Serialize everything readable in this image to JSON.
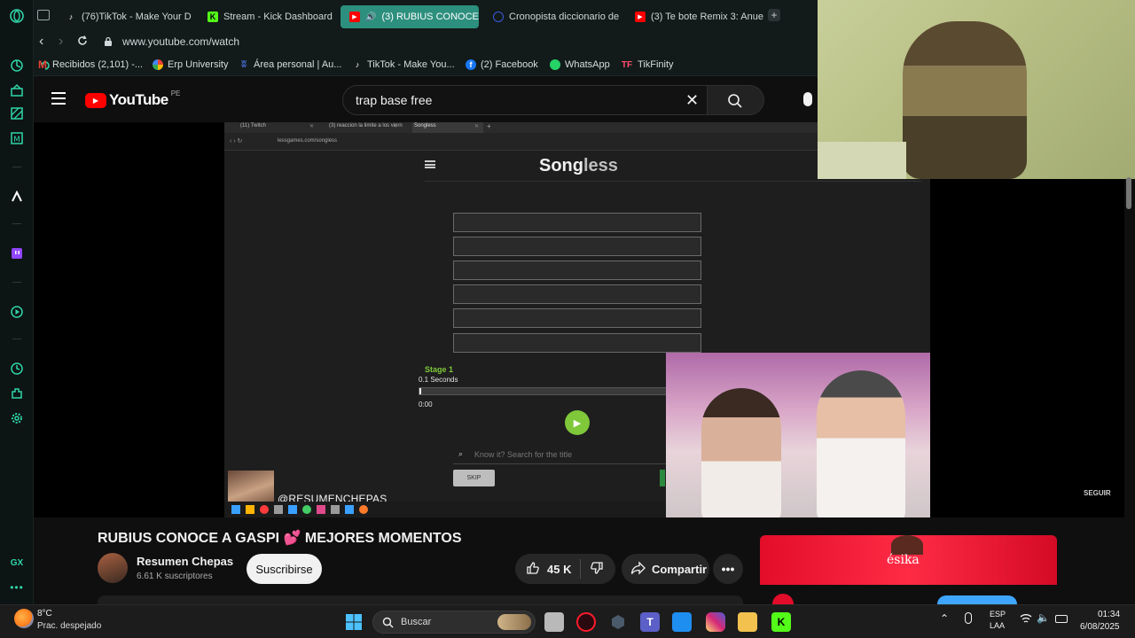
{
  "browser": {
    "tabs": [
      {
        "label": "(76)TikTok - Make Your D",
        "icon": "tiktok-icon",
        "active": false
      },
      {
        "label": "Stream - Kick Dashboard",
        "icon": "kick-icon",
        "active": false
      },
      {
        "label": "(3) RUBIUS CONOCE",
        "icon": "youtube-icon",
        "active": true
      },
      {
        "label": "Cronopista diccionario de",
        "icon": "globe-icon",
        "active": false
      },
      {
        "label": "(3) Te bote Remix 3: Anue",
        "icon": "youtube-icon",
        "active": false
      }
    ],
    "url": "www.youtube.com/watch",
    "bookmarks": [
      {
        "label": "Recibidos (2,101) -...",
        "icon": "gmail-icon"
      },
      {
        "label": "Erp University",
        "icon": "erp-icon"
      },
      {
        "label": "Área personal | Au...",
        "icon": "moodle-icon"
      },
      {
        "label": "TikTok - Make You...",
        "icon": "tiktok-icon"
      },
      {
        "label": "(2) Facebook",
        "icon": "facebook-icon"
      },
      {
        "label": "WhatsApp",
        "icon": "whatsapp-icon"
      },
      {
        "label": "TikFinity",
        "icon": "tikfinity-icon"
      }
    ]
  },
  "youtube": {
    "logo_text": "YouTube",
    "country": "PE",
    "search_value": "trap base free"
  },
  "video": {
    "inner_tabs": [
      "(11) Twitch",
      "(3) reaccion la limite a los viern",
      "Songless"
    ],
    "inner_url": "lessgames.com/songless",
    "app_title_bold": "Song",
    "app_title_light": "less",
    "stage_label": "Stage 1",
    "seconds_label": "0.1 Seconds",
    "time_label": "0:00",
    "search_placeholder": "Know it? Search for the title",
    "skip_label": "SKIP",
    "watermark": "@RESUMENCHEPAS",
    "follow_label": "SEGUIR"
  },
  "meta": {
    "title": "RUBIUS CONOCE A GASPI 💕 MEJORES MOMENTOS",
    "channel_name": "Resumen Chepas",
    "subscribers": "6.61 K suscriptores",
    "subscribe_label": "Suscribirse",
    "likes": "45 K",
    "share_label": "Compartir",
    "ad_brand": "ésika"
  },
  "taskbar": {
    "temperature": "8°C",
    "weather": "Prac. despejado",
    "search_label": "Buscar",
    "lang_top": "ESP",
    "lang_bottom": "LAA",
    "time": "01:34",
    "date": "6/08/2025"
  },
  "sidebar": {
    "bottom_label": "GX"
  },
  "colors": {
    "accent": "#2fd6a8",
    "youtube_red": "#ff0000",
    "songless_green": "#7ec83a"
  }
}
